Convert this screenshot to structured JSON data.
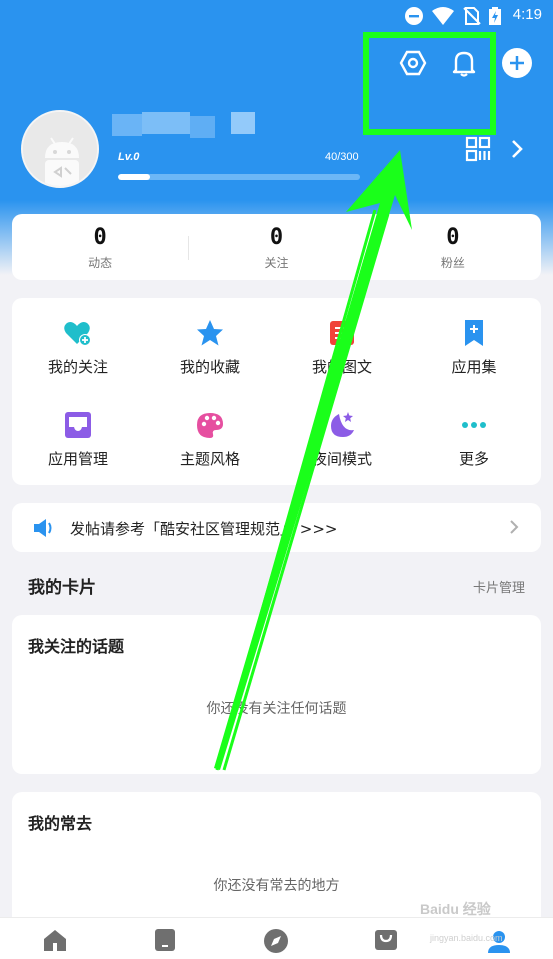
{
  "status_bar": {
    "time": "4:19",
    "icons": [
      "do-not-disturb-icon",
      "wifi-icon",
      "no-sim-icon",
      "battery-charging-icon"
    ]
  },
  "header": {
    "top_icons": [
      "settings-hexagon-icon",
      "bell-icon",
      "add-circle-icon"
    ],
    "level": "Lv.0",
    "experience": "40/300",
    "experience_progress": 0.133,
    "right_icons": [
      "qr-code-icon",
      "chevron-right-icon"
    ]
  },
  "stats": [
    {
      "value": "0",
      "label": "动态"
    },
    {
      "value": "0",
      "label": "关注"
    },
    {
      "value": "0",
      "label": "粉丝"
    }
  ],
  "menu": [
    {
      "label": "我的关注",
      "icon": "heart-plus-icon",
      "color": "#1fbecb"
    },
    {
      "label": "我的收藏",
      "icon": "star-icon",
      "color": "#2a93ef"
    },
    {
      "label": "我的图文",
      "icon": "article-icon",
      "color": "#f0433a"
    },
    {
      "label": "应用集",
      "icon": "bookmark-plus-icon",
      "color": "#2a93ef"
    },
    {
      "label": "应用管理",
      "icon": "inbox-icon",
      "color": "#8c5ce6"
    },
    {
      "label": "主题风格",
      "icon": "palette-icon",
      "color": "#e64fa0"
    },
    {
      "label": "夜间模式",
      "icon": "moon-stars-icon",
      "color": "#8c5ce6"
    },
    {
      "label": "更多",
      "icon": "more-dots-icon",
      "color": "#1fbecb"
    }
  ],
  "notice": {
    "text": "发帖请参考「酷安社区管理规范」 >>>",
    "icon": "speaker-icon"
  },
  "cards_section": {
    "title": "我的卡片",
    "manage_link": "卡片管理"
  },
  "topic_card": {
    "title": "我关注的话题",
    "empty_text": "你还没有关注任何话题"
  },
  "often_card": {
    "title": "我的常去",
    "empty_text": "你还没有常去的地方"
  },
  "bottom_nav": [
    {
      "icon": "home-icon",
      "active": false
    },
    {
      "icon": "digital-icon",
      "active": false
    },
    {
      "icon": "compass-icon",
      "active": false
    },
    {
      "icon": "shopping-bag-icon",
      "active": false
    },
    {
      "icon": "user-icon",
      "active": true
    }
  ],
  "colors": {
    "brand": "#2a93ef",
    "annotation": "#1aff1a"
  },
  "watermark": {
    "main": "Baidu 经验",
    "sub": "jingyan.baidu.com"
  }
}
